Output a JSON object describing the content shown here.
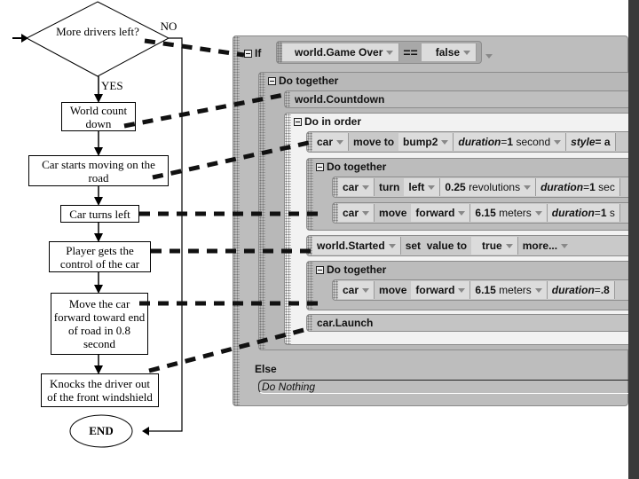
{
  "flowchart": {
    "decision": "More drivers left?",
    "no_label": "NO",
    "yes_label": "YES",
    "steps": [
      "World count down",
      "Car starts moving on the road",
      "Car turns left",
      "Player gets the control of the car",
      "Move the car forward toward end of road in 0.8 second",
      "Knocks the driver out of the front windshield"
    ],
    "end": "END"
  },
  "code": {
    "if_label": "If",
    "condition": {
      "left": "world.Game Over",
      "operator": "==",
      "right": "false"
    },
    "do_together_1": "Do together",
    "countdown": "world.Countdown",
    "do_in_order": "Do in order",
    "move_to": {
      "object": "car",
      "verb": "move to",
      "target": "bump2",
      "duration_key": "duration",
      "duration_eq": " = ",
      "duration_val": "1",
      "duration_unit": "second",
      "style_key": "style",
      "style_eq": " = a"
    },
    "do_together_2": "Do together",
    "turn": {
      "object": "car",
      "verb": "turn",
      "dir": "left",
      "amount": "0.25",
      "unit": "revolutions",
      "duration_key": "duration",
      "duration_eq": " = ",
      "duration_val": "1",
      "duration_unit": "sec"
    },
    "move1": {
      "object": "car",
      "verb": "move",
      "dir": "forward",
      "amount": "6.15",
      "unit": "meters",
      "duration_key": "duration",
      "duration_eq": " = ",
      "duration_val": "1",
      "duration_unit": "s"
    },
    "set_started": {
      "object": "world.Started",
      "verb": "set  value to",
      "value": "true",
      "more": "more..."
    },
    "do_together_3": "Do together",
    "move2": {
      "object": "car",
      "verb": "move",
      "dir": "forward",
      "amount": "6.15",
      "unit": "meters",
      "duration_key": "duration",
      "duration_eq": " = ",
      "duration_val": ".8"
    },
    "launch": "car.Launch",
    "else_label": "Else",
    "do_nothing": "Do Nothing"
  }
}
